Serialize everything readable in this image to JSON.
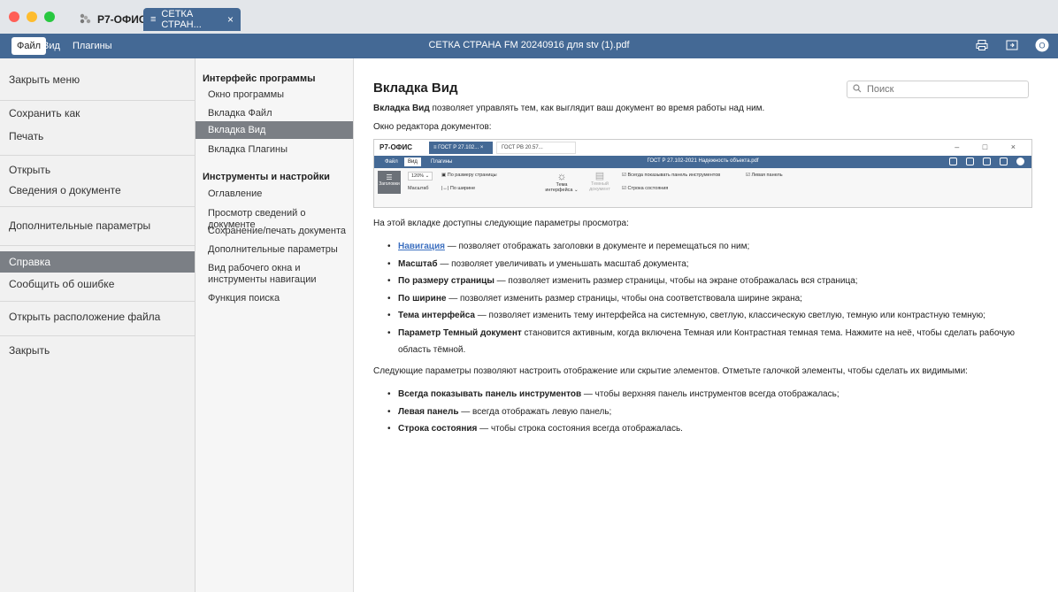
{
  "window": {
    "app_tab": "Р7-ОФИС",
    "doc_tab": "СЕТКА СТРАН...",
    "doc_tab_close": "×",
    "colors": {
      "accent": "#446995",
      "selected": "#7b7f85"
    }
  },
  "menubar": {
    "tabs": [
      "Файл",
      "Вид",
      "Плагины"
    ],
    "title": "СЕТКА СТРАНА FM 20240916 для stv (1).pdf",
    "icons": [
      "print-icon",
      "open-location-icon",
      "user-avatar-icon"
    ],
    "avatar_letter": "O"
  },
  "filemenu": {
    "items": [
      "Закрыть меню",
      "Сохранить как",
      "Печать",
      "Открыть",
      "Сведения о документе",
      "Дополнительные параметры",
      "Справка",
      "Сообщить об ошибке",
      "Открыть расположение файла",
      "Закрыть"
    ],
    "selected": "Справка"
  },
  "helpnav": {
    "section1": "Интерфейс программы",
    "s1_items": [
      "Окно программы",
      "Вкладка Файл",
      "Вкладка Вид",
      "Вкладка Плагины"
    ],
    "section2": "Инструменты и настройки",
    "s2_items": [
      "Оглавление",
      "Просмотр сведений о документе",
      "Сохранение/печать документа",
      "Дополнительные параметры",
      "Вид рабочего окна и инструменты навигации",
      "Функция поиска"
    ],
    "selected": "Вкладка Вид"
  },
  "content": {
    "title": "Вкладка Вид",
    "search_placeholder": "Поиск",
    "intro_bold": "Вкладка Вид",
    "intro_rest": " позволяет управлять тем, как выглядит ваш документ во время работы над ним.",
    "editor_label": "Окно редактора документов:",
    "params_intro": "На этой вкладке доступны следующие параметры просмотра:",
    "bullets1": [
      {
        "term": "Навигация",
        "text": " — позволяет отображать заголовки в документе и перемещаться по ним;"
      },
      {
        "term": "Масштаб",
        "text": " — позволяет увеличивать и уменьшать масштаб документа;"
      },
      {
        "term": "По размеру страницы",
        "text": " — позволяет изменить размер страницы, чтобы на экране отображалась вся страница;"
      },
      {
        "term": "По ширине",
        "text": " — позволяет изменить размер страницы, чтобы она соответствовала ширине экрана;"
      },
      {
        "term": "Тема интерфейса",
        "text": " — позволяет изменить тему интерфейса на системную, светлую, классическую светлую, темную или контрастную темную;"
      },
      {
        "term": "Параметр Темный документ",
        "text": " становится активным, когда включена Темная или Контрастная темная тема. Нажмите на неё, чтобы сделать рабочую область тёмной."
      }
    ],
    "visibility_intro": "Следующие параметры позволяют настроить отображение или скрытие элементов. Отметьте галочкой элементы, чтобы сделать их видимыми:",
    "bullets2": [
      {
        "term": "Всегда показывать панель инструментов",
        "text": " — чтобы верхняя панель инструментов всегда отображалась;"
      },
      {
        "term": "Левая панель",
        "text": " — всегда отображать левую панель;"
      },
      {
        "term": "Строка состояния",
        "text": " — чтобы строка состояния всегда отображалась."
      }
    ]
  },
  "embedded": {
    "app": "Р7-ОФИС",
    "tab1": "ГОСТ Р 27.102...",
    "tab1_close": "×",
    "tab2": "ГОСТ РВ 20.57...",
    "window_controls": "– □ ×",
    "menu": [
      "Файл",
      "Вид",
      "Плагины"
    ],
    "doc_title": "ГОСТ Р 27.102-2021 Надежность объекта.pdf",
    "headers_btn": "Заголовки",
    "zoom": "120% ⌄",
    "fit_page": "По размеру страницы",
    "scale_label": "Масштаб",
    "fit_width": "По ширине",
    "theme_line1": "Тема",
    "theme_line2": "интерфейса ⌄",
    "dark_line1": "Темный",
    "dark_line2": "документ",
    "chk_toolbar": "Всегда показывать панель инструментов",
    "chk_left": "Левая панель",
    "chk_status": "Строка состояния"
  }
}
